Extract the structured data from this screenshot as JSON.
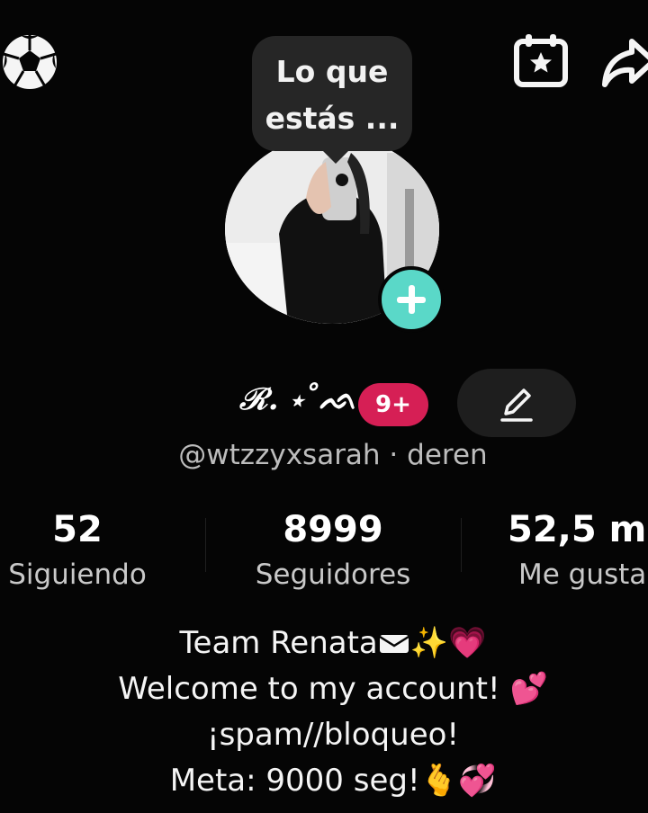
{
  "tooltip": {
    "line1": "Lo que",
    "line2": "estás ..."
  },
  "profile": {
    "display_name": "ℛ. ⋆˚ᨒ",
    "notification_badge": "9+",
    "handle": "@wtzzyxsarah · deren"
  },
  "stats": [
    {
      "value": "52",
      "label": "Siguiendo"
    },
    {
      "value": "8999",
      "label": "Seguidores"
    },
    {
      "value": "52,5 m",
      "label": "Me gusta"
    }
  ],
  "bio": {
    "line1": "Team Renata",
    "line2": "Welcome to my account!",
    "line3": "¡spam//bloqueo!",
    "line4": "Meta: 9000 seg!"
  },
  "colors": {
    "accent_teal": "#5ad8c8",
    "badge_red": "#d61f55",
    "background": "#050505"
  }
}
